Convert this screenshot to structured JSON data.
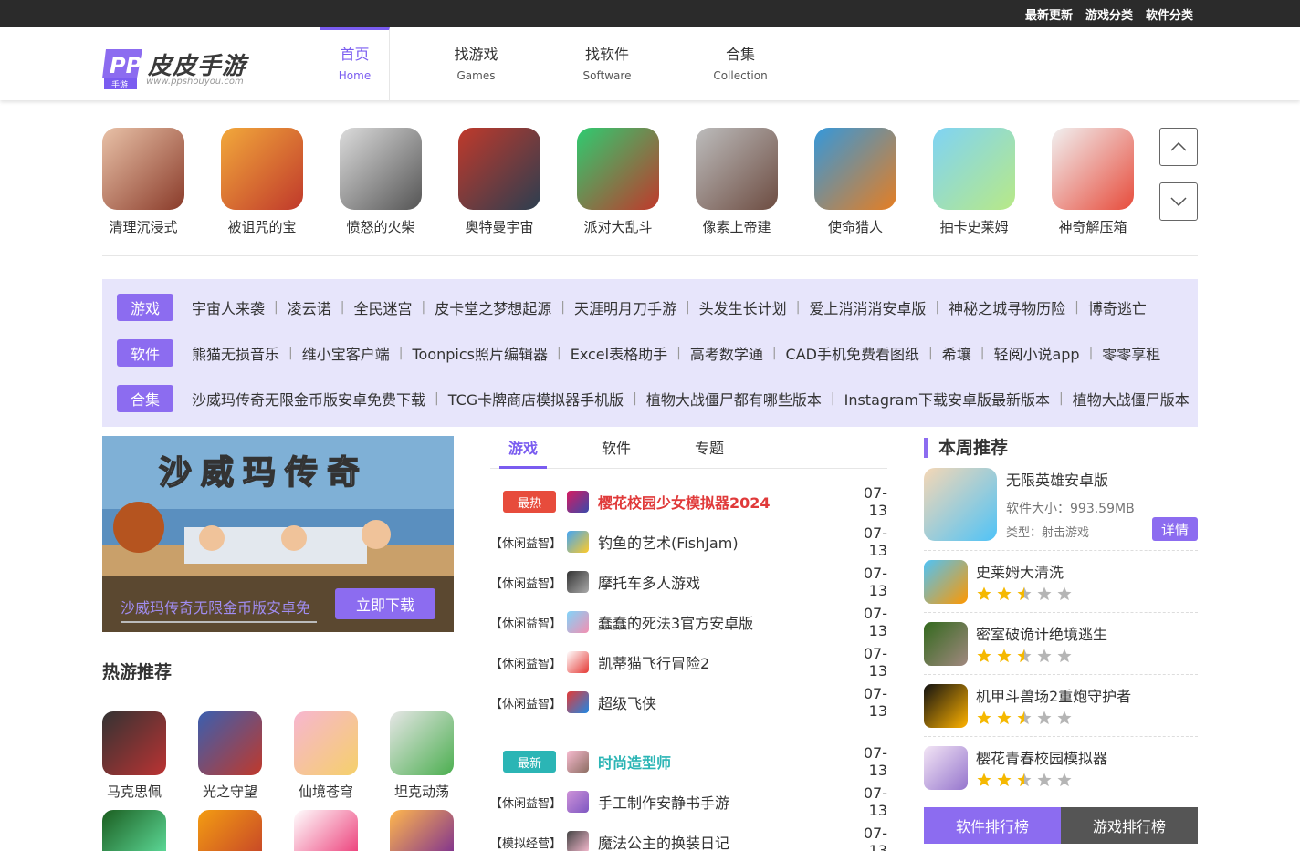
{
  "topbar": {
    "links": [
      "最新更新",
      "游戏分类",
      "软件分类"
    ]
  },
  "logo": {
    "name": "皮皮手游",
    "url": "www.ppshouyou.com",
    "tag": "手游"
  },
  "nav": [
    {
      "cn": "首页",
      "en": "Home"
    },
    {
      "cn": "找游戏",
      "en": "Games"
    },
    {
      "cn": "找软件",
      "en": "Software"
    },
    {
      "cn": "合集",
      "en": "Collection"
    }
  ],
  "carousel": [
    "清理沉浸式",
    "被诅咒的宝",
    "愤怒的火柴",
    "奥特曼宇宙",
    "派对大乱斗",
    "像素上帝建",
    "使命猎人",
    "抽卡史莱姆",
    "神奇解压箱"
  ],
  "tags": {
    "game": {
      "label": "游戏",
      "items": [
        "宇宙人来袭",
        "凌云诺",
        "全民迷宫",
        "皮卡堂之梦想起源",
        "天涯明月刀手游",
        "头发生长计划",
        "爱上消消消安卓版",
        "神秘之城寻物历险",
        "博奇逃亡"
      ]
    },
    "soft": {
      "label": "软件",
      "items": [
        "熊猫无损音乐",
        "维小宝客户端",
        "Toonpics照片编辑器",
        "Excel表格助手",
        "高考数学通",
        "CAD手机免费看图纸",
        "希壤",
        "轻阅小说app",
        "零零享租"
      ]
    },
    "coll": {
      "label": "合集",
      "items": [
        "沙威玛传奇无限金币版安卓免费下载",
        "TCG卡牌商店模拟器手机版",
        "植物大战僵尸都有哪些版本",
        "Instagram下载安卓版最新版本",
        "植物大战僵尸版本"
      ]
    }
  },
  "banner": {
    "title": "沙威玛传奇",
    "text": "沙威玛传奇无限金币版安卓免",
    "button": "立即下载"
  },
  "hot": {
    "title": "热游推荐",
    "items": [
      "马克思佩",
      "光之守望",
      "仙境苍穹",
      "坦克动荡"
    ]
  },
  "middle": {
    "tabs": [
      "游戏",
      "软件",
      "专题"
    ],
    "group1": {
      "pill": "最热",
      "top": {
        "name": "樱花校园少女模拟器2024",
        "date": "07-13"
      },
      "rows": [
        {
          "cat": "【休闲益智】",
          "name": "钓鱼的艺术(FishJam)",
          "date": "07-13"
        },
        {
          "cat": "【休闲益智】",
          "name": "摩托车多人游戏",
          "date": "07-13"
        },
        {
          "cat": "【休闲益智】",
          "name": "蠢蠢的死法3官方安卓版",
          "date": "07-13"
        },
        {
          "cat": "【休闲益智】",
          "name": "凯蒂猫飞行冒险2",
          "date": "07-13"
        },
        {
          "cat": "【休闲益智】",
          "name": "超级飞侠",
          "date": "07-13"
        }
      ]
    },
    "group2": {
      "pill": "最新",
      "top": {
        "name": "时尚造型师",
        "date": "07-13"
      },
      "rows": [
        {
          "cat": "【休闲益智】",
          "name": "手工制作安静书手游",
          "date": "07-13"
        },
        {
          "cat": "【模拟经营】",
          "name": "魔法公主的换装日记",
          "date": "07-13"
        }
      ]
    }
  },
  "right": {
    "title": "本周推荐",
    "featured": {
      "name": "无限英雄安卓版",
      "size": "软件大小：993.59MB",
      "type": "类型：射击游戏",
      "detail": "详情"
    },
    "list": [
      {
        "name": "史莱姆大清洗",
        "stars": 2.5
      },
      {
        "name": "密室破诡计绝境逃生",
        "stars": 2.5
      },
      {
        "name": "机甲斗兽场2重炮守护者",
        "stars": 2.5
      },
      {
        "name": "樱花青春校园模拟器",
        "stars": 2.5
      }
    ],
    "rank_tabs": [
      "软件排行榜",
      "游戏排行榜"
    ]
  }
}
